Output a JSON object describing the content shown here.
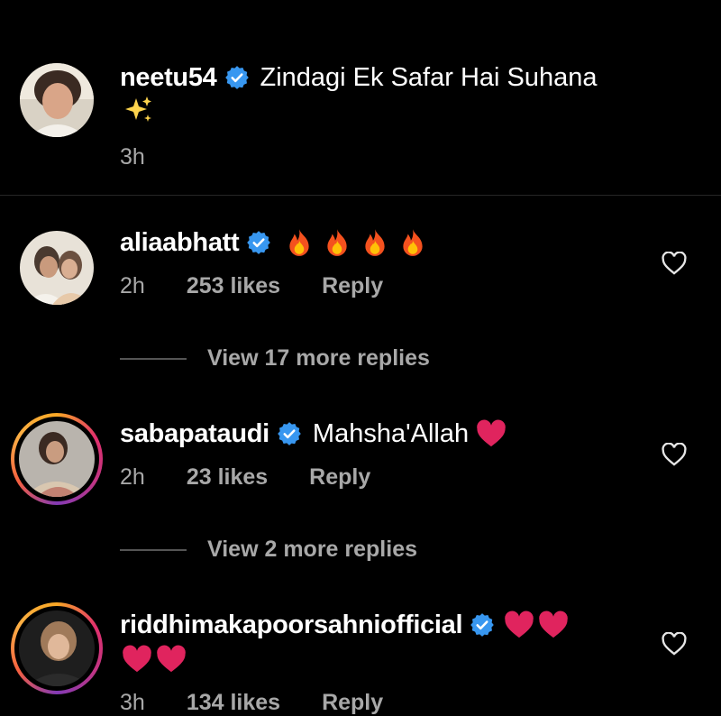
{
  "post": {
    "username": "neetu54",
    "caption": "Zindagi Ek Safar Hai Suhana",
    "caption_emoji": "sparkles",
    "time": "3h"
  },
  "comments": [
    {
      "username": "aliaabhatt",
      "verified": true,
      "text": "",
      "emoji": [
        "fire",
        "fire",
        "fire",
        "fire"
      ],
      "time": "2h",
      "likes": "253 likes",
      "reply": "Reply",
      "view_replies": "View 17 more replies"
    },
    {
      "username": "sabapataudi",
      "verified": true,
      "text": "Mahsha'Allah",
      "emoji": [
        "red-heart"
      ],
      "time": "2h",
      "likes": "23 likes",
      "reply": "Reply",
      "view_replies": "View 2 more replies"
    },
    {
      "username": "riddhimakapoorsahniofficial",
      "verified": true,
      "text": "",
      "emoji": [
        "red-heart",
        "red-heart",
        "red-heart",
        "red-heart"
      ],
      "time": "3h",
      "likes": "134 likes",
      "reply": "Reply"
    }
  ],
  "colors": {
    "background": "#000000",
    "text": "#ffffff",
    "meta": "#a8a8a8",
    "verified": "#3897f0",
    "heart": "#e0245e"
  }
}
